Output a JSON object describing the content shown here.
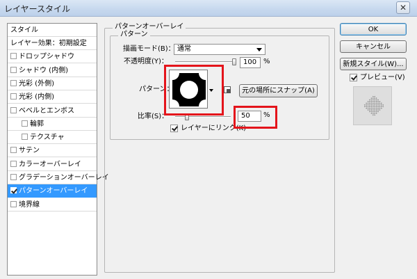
{
  "window": {
    "title": "レイヤースタイル",
    "close_glyph": "✕"
  },
  "style_list": {
    "header": "スタイル",
    "items": [
      {
        "label": "レイヤー効果：初期設定",
        "checkbox": false,
        "checked": false,
        "indent": false,
        "selected": false
      },
      {
        "label": "ドロップシャドウ",
        "checkbox": true,
        "checked": false,
        "indent": false,
        "selected": false
      },
      {
        "label": "シャドウ (内側)",
        "checkbox": true,
        "checked": false,
        "indent": false,
        "selected": false
      },
      {
        "label": "光彩 (外側)",
        "checkbox": true,
        "checked": false,
        "indent": false,
        "selected": false
      },
      {
        "label": "光彩 (内側)",
        "checkbox": true,
        "checked": false,
        "indent": false,
        "selected": false
      },
      {
        "label": "ベベルとエンボス",
        "checkbox": true,
        "checked": false,
        "indent": false,
        "selected": false
      },
      {
        "label": "輪郭",
        "checkbox": true,
        "checked": false,
        "indent": true,
        "selected": false
      },
      {
        "label": "テクスチャ",
        "checkbox": true,
        "checked": false,
        "indent": true,
        "selected": false
      },
      {
        "label": "サテン",
        "checkbox": true,
        "checked": false,
        "indent": false,
        "selected": false
      },
      {
        "label": "カラーオーバーレイ",
        "checkbox": true,
        "checked": false,
        "indent": false,
        "selected": false
      },
      {
        "label": "グラデーションオーバーレイ",
        "checkbox": true,
        "checked": false,
        "indent": false,
        "selected": false
      },
      {
        "label": "パターンオーバーレイ",
        "checkbox": true,
        "checked": true,
        "indent": false,
        "selected": true
      },
      {
        "label": "境界線",
        "checkbox": true,
        "checked": false,
        "indent": false,
        "selected": false
      }
    ]
  },
  "pattern_overlay": {
    "group_title": "パターンオーバーレイ",
    "subgroup_title": "パターン",
    "blend_mode_label": "描画モード(B)：",
    "blend_mode_value": "通常",
    "opacity_label": "不透明度(Y)：",
    "opacity_value": "100",
    "opacity_unit": "%",
    "opacity_level": 1.0,
    "pattern_label": "パターン：",
    "snap_button": "元の場所にスナップ(A)",
    "scale_label": "比率(S)：",
    "scale_value": "50",
    "scale_unit": "%",
    "scale_level": 0.05,
    "link_label": "レイヤーにリンク(K)",
    "link_checked": true
  },
  "buttons": {
    "ok": "OK",
    "cancel": "キャンセル",
    "new_style": "新規スタイル(W)...",
    "preview_label": "プレビュー(V)",
    "preview_checked": true
  },
  "colors": {
    "highlight": "#e4141b",
    "selection": "#3399ff"
  }
}
